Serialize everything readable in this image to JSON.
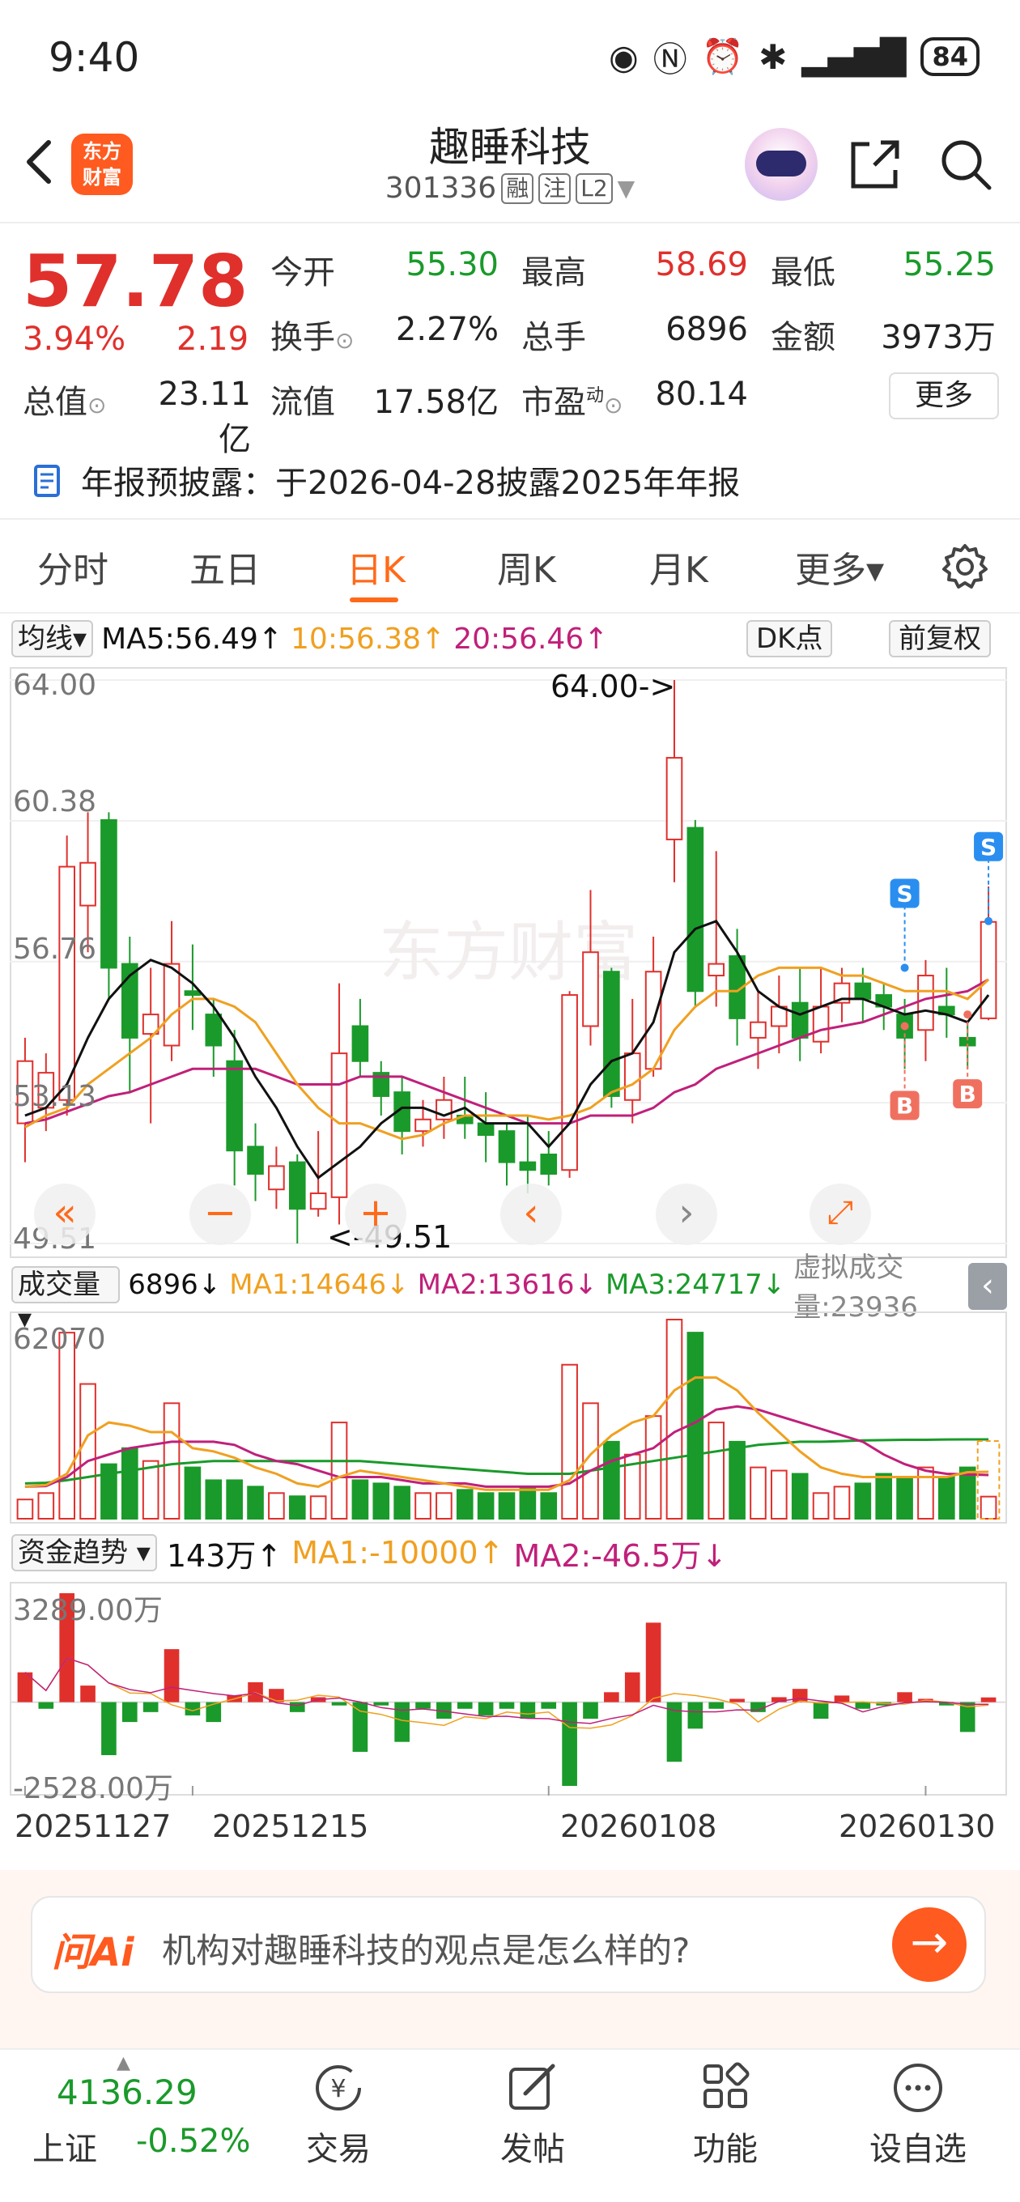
{
  "status_bar": {
    "time": "9:40",
    "battery": "84"
  },
  "header": {
    "logo_text_line1": "东方",
    "logo_text_line2": "财富",
    "stock_name": "趣睡科技",
    "stock_code": "301336",
    "badge_margin": "融",
    "badge_follow": "注",
    "badge_level": "L2"
  },
  "quote": {
    "price": "57.78",
    "change_pct": "3.94%",
    "change": "2.19",
    "fields": [
      {
        "label": "今开",
        "value": "55.30",
        "color": "green"
      },
      {
        "label": "最高",
        "value": "58.69",
        "color": "red"
      },
      {
        "label": "最低",
        "value": "55.25",
        "color": "green"
      },
      {
        "label": "换手",
        "value": "2.27%",
        "color": "dark"
      },
      {
        "label": "总手",
        "value": "6896",
        "color": "dark"
      },
      {
        "label": "金额",
        "value": "3973万",
        "color": "dark"
      },
      {
        "label": "总值",
        "value": "23.11亿",
        "color": "dark"
      },
      {
        "label": "流值",
        "value": "17.58亿",
        "color": "dark"
      },
      {
        "label": "市盈",
        "value": "80.14",
        "color": "dark"
      }
    ],
    "pe_superscript": "动",
    "more_label": "更多"
  },
  "notice": {
    "text": "年报预披露：于2026-04-28披露2025年年报"
  },
  "tabs": [
    {
      "label": "分时"
    },
    {
      "label": "五日"
    },
    {
      "label": "日K"
    },
    {
      "label": "周K"
    },
    {
      "label": "月K"
    },
    {
      "label": "更多▾"
    }
  ],
  "active_tab": "日K",
  "ma_bar": {
    "dropdown": "均线",
    "ma5": "MA5:56.49↑",
    "ma10": "10:56.38↑",
    "ma20": "20:56.46↑",
    "dk_button": "DK点",
    "adjust_button": "前复权"
  },
  "kline": {
    "y_labels": [
      "64.00",
      "60.38",
      "56.76",
      "53.13",
      "49.51"
    ],
    "max_label": "64.00->",
    "min_label": "<-49.51",
    "buy_marker": "B",
    "sell_marker": "S",
    "watermark": "东方财富"
  },
  "volume_bar": {
    "dropdown": "成交量",
    "value": "6896↓",
    "ma1": "MA1:14646↓",
    "ma2": "MA2:13616↓",
    "ma3": "MA3:24717↓",
    "virtual": "虚拟成交量:23936",
    "y_max": "62070"
  },
  "cash_bar": {
    "dropdown": "资金趋势",
    "value": "143万↑",
    "ma1": "MA1:-10000↑",
    "ma2": "MA2:-46.5万↓",
    "y_max": "3289.00万",
    "y_min": "-2528.00万"
  },
  "dates": [
    "20251127",
    "20251215",
    "20260108",
    "20260130"
  ],
  "ai": {
    "logo": "问Ai",
    "placeholder": "机构对趣睡科技的观点是怎么样的?"
  },
  "bottom_nav": {
    "index_value": "4136.29",
    "index_name": "上证",
    "index_change": "-0.52%",
    "items": [
      {
        "label": "交易",
        "icon": "trade-icon"
      },
      {
        "label": "发帖",
        "icon": "post-icon"
      },
      {
        "label": "功能",
        "icon": "grid-icon"
      },
      {
        "label": "设自选",
        "icon": "more-dots-icon"
      }
    ]
  },
  "colors": {
    "up": "#e0302c",
    "down": "#1a9a2a",
    "accent": "#ff6a1a",
    "ma5": "#111111",
    "ma10": "#f0a020",
    "ma20": "#c0207a"
  },
  "chart_data": {
    "type": "candlestick",
    "price_axis": {
      "min": 49.51,
      "max": 64.0,
      "labels": [
        64.0,
        60.38,
        56.76,
        53.13,
        49.51
      ]
    },
    "candles": [
      {
        "o": 52.6,
        "c": 54.2,
        "h": 54.8,
        "l": 51.6
      },
      {
        "o": 53.0,
        "c": 53.9,
        "h": 54.4,
        "l": 52.4
      },
      {
        "o": 53.2,
        "c": 59.2,
        "h": 60.0,
        "l": 52.8
      },
      {
        "o": 58.2,
        "c": 59.3,
        "h": 60.6,
        "l": 57.0
      },
      {
        "o": 60.4,
        "c": 56.6,
        "h": 60.6,
        "l": 55.8
      },
      {
        "o": 56.7,
        "c": 54.8,
        "h": 57.4,
        "l": 53.4
      },
      {
        "o": 54.9,
        "c": 55.4,
        "h": 56.6,
        "l": 52.6
      },
      {
        "o": 54.6,
        "c": 56.7,
        "h": 57.8,
        "l": 54.2
      },
      {
        "o": 56.0,
        "c": 55.9,
        "h": 57.2,
        "l": 55.0
      },
      {
        "o": 55.4,
        "c": 54.6,
        "h": 55.8,
        "l": 53.8
      },
      {
        "o": 54.2,
        "c": 51.9,
        "h": 55.0,
        "l": 51.0
      },
      {
        "o": 52.0,
        "c": 51.3,
        "h": 52.6,
        "l": 50.6
      },
      {
        "o": 50.9,
        "c": 51.5,
        "h": 52.0,
        "l": 50.4
      },
      {
        "o": 51.6,
        "c": 50.4,
        "h": 51.8,
        "l": 49.51
      },
      {
        "o": 50.4,
        "c": 50.8,
        "h": 52.4,
        "l": 50.2
      },
      {
        "o": 50.7,
        "c": 54.4,
        "h": 56.2,
        "l": 50.0
      },
      {
        "o": 55.1,
        "c": 54.2,
        "h": 55.8,
        "l": 53.8
      },
      {
        "o": 53.9,
        "c": 53.3,
        "h": 54.2,
        "l": 52.8
      },
      {
        "o": 53.4,
        "c": 52.4,
        "h": 53.8,
        "l": 51.8
      },
      {
        "o": 52.4,
        "c": 52.7,
        "h": 53.2,
        "l": 52.0
      },
      {
        "o": 52.7,
        "c": 53.2,
        "h": 53.8,
        "l": 52.2
      },
      {
        "o": 52.8,
        "c": 52.6,
        "h": 53.8,
        "l": 52.2
      },
      {
        "o": 52.6,
        "c": 52.3,
        "h": 53.4,
        "l": 51.6
      },
      {
        "o": 52.4,
        "c": 51.6,
        "h": 52.6,
        "l": 51.0
      },
      {
        "o": 51.6,
        "c": 51.4,
        "h": 52.8,
        "l": 50.8
      },
      {
        "o": 51.8,
        "c": 51.3,
        "h": 52.4,
        "l": 51.0
      },
      {
        "o": 51.4,
        "c": 55.9,
        "h": 56.0,
        "l": 51.2
      },
      {
        "o": 55.1,
        "c": 57.0,
        "h": 58.6,
        "l": 54.6
      },
      {
        "o": 56.5,
        "c": 53.3,
        "h": 56.6,
        "l": 53.0
      },
      {
        "o": 53.2,
        "c": 54.4,
        "h": 55.8,
        "l": 52.6
      },
      {
        "o": 54.0,
        "c": 56.5,
        "h": 57.4,
        "l": 53.8
      },
      {
        "o": 59.9,
        "c": 62.0,
        "h": 64.0,
        "l": 58.8
      },
      {
        "o": 60.2,
        "c": 56.0,
        "h": 60.4,
        "l": 55.6
      },
      {
        "o": 56.4,
        "c": 56.7,
        "h": 59.6,
        "l": 55.6
      },
      {
        "o": 56.9,
        "c": 55.3,
        "h": 57.6,
        "l": 54.6
      },
      {
        "o": 54.8,
        "c": 55.2,
        "h": 56.0,
        "l": 54.0
      },
      {
        "o": 55.1,
        "c": 55.6,
        "h": 56.4,
        "l": 54.4
      },
      {
        "o": 55.7,
        "c": 54.8,
        "h": 56.6,
        "l": 54.2
      },
      {
        "o": 54.7,
        "c": 55.6,
        "h": 56.6,
        "l": 54.4
      },
      {
        "o": 55.7,
        "c": 56.2,
        "h": 56.6,
        "l": 55.2
      },
      {
        "o": 56.2,
        "c": 55.8,
        "h": 56.6,
        "l": 55.2
      },
      {
        "o": 55.9,
        "c": 55.6,
        "h": 56.2,
        "l": 55.0
      },
      {
        "o": 55.4,
        "c": 54.8,
        "h": 55.8,
        "l": 54.0
      },
      {
        "o": 55.0,
        "c": 56.4,
        "h": 56.8,
        "l": 54.2
      },
      {
        "o": 55.6,
        "c": 55.4,
        "h": 56.6,
        "l": 54.8
      },
      {
        "o": 54.8,
        "c": 54.6,
        "h": 55.2,
        "l": 54.0
      },
      {
        "o": 55.3,
        "c": 57.78,
        "h": 58.69,
        "l": 55.25
      }
    ],
    "ma5": [
      52.8,
      53.0,
      53.6,
      54.8,
      55.8,
      56.4,
      56.8,
      56.6,
      56.2,
      55.6,
      54.8,
      53.8,
      53.0,
      52.0,
      51.2,
      51.6,
      52.0,
      52.6,
      53.0,
      53.0,
      52.8,
      53.0,
      52.6,
      52.6,
      52.6,
      52.0,
      52.6,
      53.6,
      54.2,
      54.4,
      55.2,
      57.0,
      57.6,
      57.8,
      57.0,
      56.0,
      55.6,
      55.4,
      55.6,
      55.8,
      55.8,
      55.6,
      55.4,
      55.5,
      55.4,
      55.2,
      55.9
    ],
    "ma10": [
      52.5,
      52.8,
      53.0,
      53.6,
      54.0,
      54.4,
      54.8,
      55.4,
      55.8,
      55.8,
      55.6,
      55.2,
      54.4,
      53.6,
      53.0,
      52.6,
      52.6,
      52.4,
      52.2,
      52.3,
      52.6,
      52.8,
      52.8,
      52.8,
      52.8,
      52.7,
      52.8,
      53.0,
      53.4,
      53.6,
      54.0,
      55.0,
      55.6,
      56.0,
      56.0,
      56.4,
      56.6,
      56.6,
      56.6,
      56.4,
      56.4,
      56.2,
      56.0,
      56.0,
      56.0,
      55.8,
      56.3
    ],
    "ma20": [
      52.6,
      52.7,
      52.9,
      53.1,
      53.3,
      53.4,
      53.6,
      53.8,
      54.0,
      54.0,
      54.0,
      54.0,
      53.8,
      53.6,
      53.6,
      53.6,
      53.8,
      53.8,
      53.8,
      53.6,
      53.4,
      53.2,
      53.0,
      52.8,
      52.6,
      52.6,
      52.6,
      52.8,
      52.8,
      52.8,
      53.0,
      53.4,
      53.6,
      54.0,
      54.2,
      54.4,
      54.6,
      54.8,
      55.0,
      55.1,
      55.2,
      55.4,
      55.6,
      55.8,
      55.9,
      56.0,
      56.3
    ],
    "volume": [
      6000,
      8000,
      58000,
      42000,
      17000,
      22000,
      18000,
      36000,
      16000,
      12000,
      12000,
      10000,
      8000,
      7000,
      7000,
      30000,
      12000,
      11000,
      10000,
      8000,
      8000,
      9000,
      8000,
      8000,
      10000,
      8000,
      48000,
      36000,
      24000,
      20000,
      32000,
      62070,
      58000,
      30000,
      24000,
      16000,
      15000,
      14000,
      8000,
      10000,
      11000,
      14000,
      13000,
      16000,
      13000,
      16000,
      6896
    ],
    "volume_axis_max": 62070,
    "vol_ma1": [
      10000,
      10500,
      14000,
      26000,
      30000,
      29000,
      27000,
      27000,
      22000,
      21000,
      19000,
      16000,
      14000,
      11000,
      10000,
      13000,
      15000,
      14000,
      13000,
      12000,
      11000,
      10000,
      9000,
      9000,
      9000,
      9000,
      12000,
      20000,
      26000,
      30000,
      32000,
      40000,
      44000,
      44000,
      40000,
      33000,
      27000,
      21000,
      16000,
      14000,
      13000,
      13000,
      13000,
      13000,
      13000,
      14500,
      14646
    ],
    "vol_ma2": [
      10000,
      10200,
      13000,
      18000,
      20000,
      22000,
      23000,
      24000,
      24000,
      24000,
      23000,
      20000,
      18000,
      17000,
      15000,
      13000,
      13000,
      13000,
      12000,
      11000,
      11000,
      11000,
      10000,
      10000,
      10000,
      10000,
      11000,
      15000,
      18000,
      20000,
      22000,
      27000,
      30000,
      34000,
      35000,
      34000,
      32000,
      30000,
      28000,
      26000,
      24000,
      20000,
      17000,
      15000,
      14000,
      13800,
      13616
    ],
    "vol_ma3": [
      11000,
      11200,
      12000,
      13000,
      14000,
      15000,
      16000,
      17000,
      17500,
      18000,
      18000,
      18000,
      18000,
      18000,
      18000,
      18000,
      18000,
      17500,
      17000,
      16500,
      16000,
      15500,
      15000,
      14500,
      14000,
      14000,
      14000,
      15000,
      16000,
      17000,
      18000,
      19000,
      20000,
      21000,
      22000,
      23000,
      23500,
      24000,
      24000,
      24200,
      24400,
      24500,
      24600,
      24600,
      24700,
      24717,
      24717
    ],
    "cash_axis": {
      "min": -2528,
      "max": 3289
    },
    "cash_flow": [
      900,
      -200,
      3289,
      500,
      -1600,
      -600,
      -300,
      1600,
      -400,
      -600,
      200,
      600,
      400,
      -300,
      150,
      -100,
      -1500,
      -100,
      -1200,
      -200,
      -500,
      -200,
      -400,
      -200,
      -500,
      -200,
      -2528,
      -500,
      300,
      900,
      2400,
      -1800,
      -800,
      -200,
      100,
      -300,
      150,
      400,
      -500,
      200,
      -200,
      -100,
      300,
      100,
      -100,
      -900,
      143
    ]
  }
}
